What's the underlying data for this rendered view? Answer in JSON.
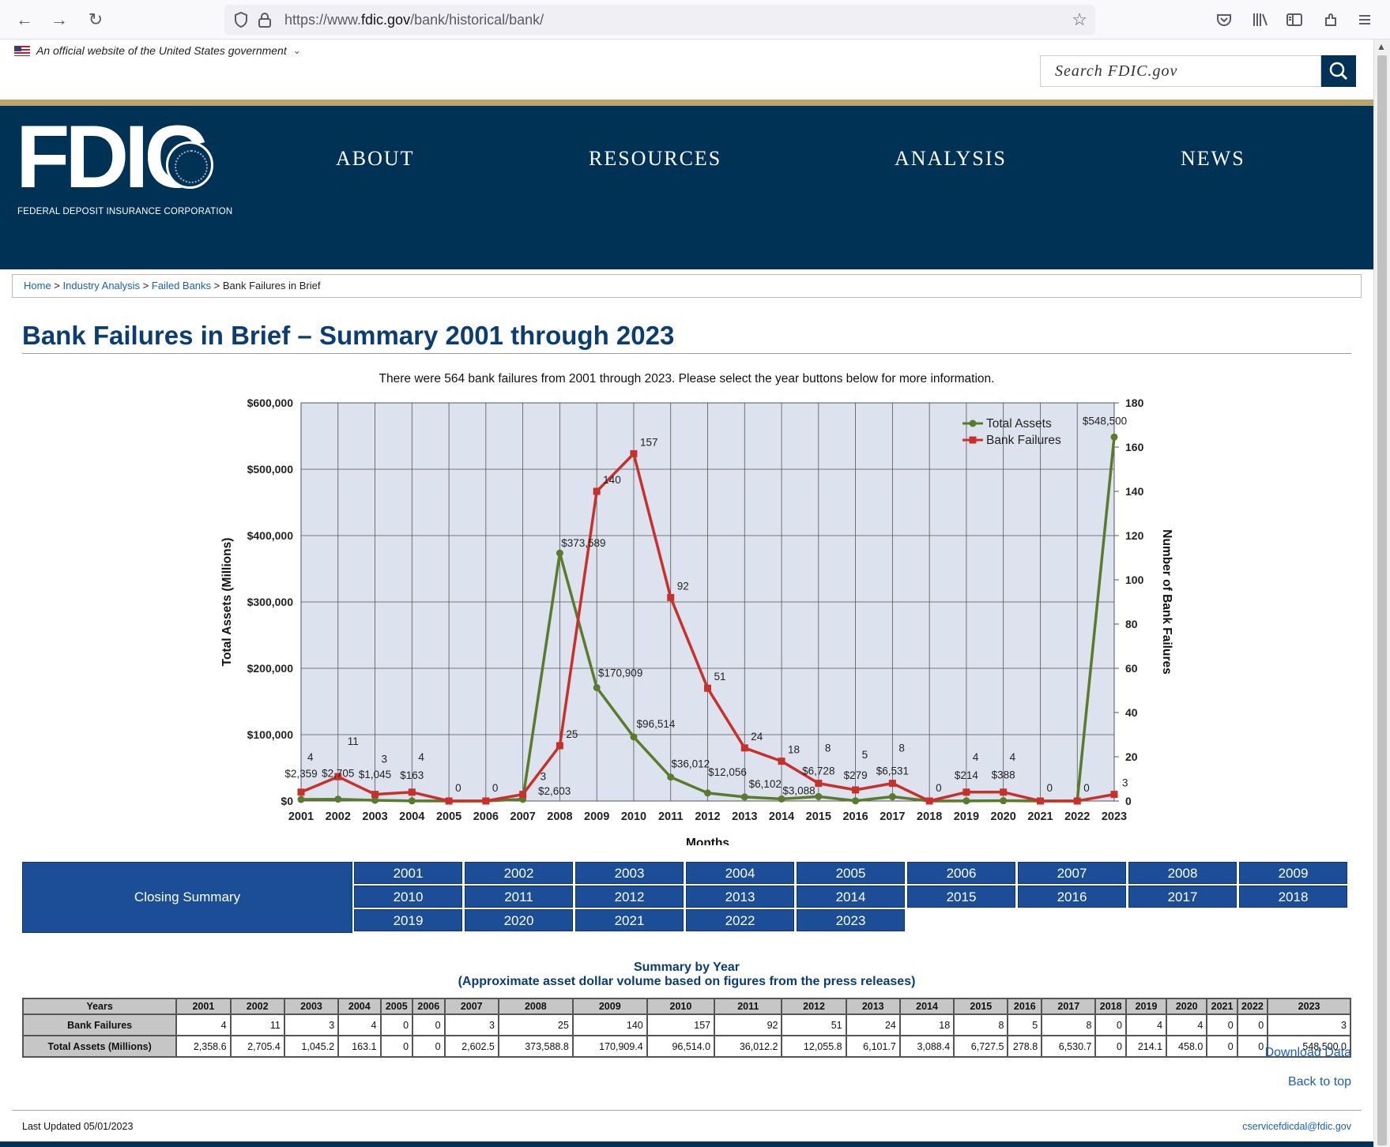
{
  "browser": {
    "back": "←",
    "forward": "→",
    "reload": "↻",
    "url_prefix": "https://www.",
    "url_domain": "fdic.gov",
    "url_path": "/bank/historical/bank/"
  },
  "gov_banner": {
    "text": "An official website of the United States government"
  },
  "search": {
    "placeholder": "Search FDIC.gov"
  },
  "logo": {
    "text": "FDIC",
    "subtitle": "FEDERAL DEPOSIT INSURANCE CORPORATION"
  },
  "nav": {
    "about": "ABOUT",
    "resources": "RESOURCES",
    "analysis": "ANALYSIS",
    "news": "NEWS"
  },
  "breadcrumb": {
    "home": "Home",
    "sep": " > ",
    "industry": "Industry Analysis",
    "failed": "Failed Banks",
    "current": "Bank Failures in Brief"
  },
  "page": {
    "title": "Bank Failures in Brief – Summary 2001 through 2023",
    "intro": "There were 564 bank failures from 2001 through 2023. Please select the year buttons below for more information."
  },
  "chart_data": {
    "type": "line",
    "xlabel": "Months",
    "ylabel": "Total Assets (Millions)",
    "y2label": "Number of Bank Failures",
    "x": [
      "2001",
      "2002",
      "2003",
      "2004",
      "2005",
      "2006",
      "2007",
      "2008",
      "2009",
      "2010",
      "2011",
      "2012",
      "2013",
      "2014",
      "2015",
      "2016",
      "2017",
      "2018",
      "2019",
      "2020",
      "2021",
      "2022",
      "2023"
    ],
    "ylim": [
      0,
      600000
    ],
    "y2lim": [
      0,
      180
    ],
    "yticks": [
      "$0",
      "$100,000",
      "$200,000",
      "$300,000",
      "$400,000",
      "$500,000",
      "$600,000"
    ],
    "y2ticks": [
      "0",
      "20",
      "40",
      "60",
      "80",
      "100",
      "120",
      "140",
      "160",
      "180"
    ],
    "legend_position": "top-right",
    "grid": true,
    "colors": {
      "total_assets": "#5a7a2e",
      "bank_failures": "#c8302c",
      "plot_bg": "#dde3ee"
    },
    "series": [
      {
        "name": "Total Assets",
        "axis": "left",
        "values": [
          2359,
          2705,
          1045,
          163,
          0,
          0,
          2603,
          373589,
          170909,
          96514,
          36012,
          12056,
          6102,
          3088,
          6728,
          279,
          6531,
          0,
          214,
          388,
          0,
          0,
          548500
        ],
        "labels": [
          "$2,359",
          "$2,705",
          "$1,045",
          "$163",
          "",
          "",
          "$2,603",
          "$373,589",
          "$170,909",
          "$96,514",
          "$36,012",
          "$12,056",
          "$6,102",
          "$3,088",
          "$6,728",
          "$279",
          "$6,531",
          "",
          "$214",
          "$388",
          "",
          "",
          "$548,500"
        ]
      },
      {
        "name": "Bank Failures",
        "axis": "right",
        "values": [
          4,
          11,
          3,
          4,
          0,
          0,
          3,
          25,
          140,
          157,
          92,
          51,
          24,
          18,
          8,
          5,
          8,
          0,
          4,
          4,
          0,
          0,
          3
        ],
        "labels": [
          "4",
          "11",
          "3",
          "4",
          "0",
          "0",
          "3",
          "25",
          "140",
          "157",
          "92",
          "51",
          "24",
          "18",
          "8",
          "5",
          "8",
          "0",
          "4",
          "4",
          "0",
          "0",
          "3"
        ]
      }
    ]
  },
  "closing_summary": "Closing Summary",
  "year_buttons": [
    "2001",
    "2002",
    "2003",
    "2004",
    "2005",
    "2006",
    "2007",
    "2008",
    "2009",
    "2010",
    "2011",
    "2012",
    "2013",
    "2014",
    "2015",
    "2016",
    "2017",
    "2018",
    "2019",
    "2020",
    "2021",
    "2022",
    "2023"
  ],
  "summary": {
    "title": "Summary by Year",
    "subtitle": "(Approximate asset dollar volume based on figures from the press releases)",
    "header_years": "Years",
    "row_failures": "Bank Failures",
    "row_assets": "Total Assets (Millions)",
    "years": [
      "2001",
      "2002",
      "2003",
      "2004",
      "2005",
      "2006",
      "2007",
      "2008",
      "2009",
      "2010",
      "2011",
      "2012",
      "2013",
      "2014",
      "2015",
      "2016",
      "2017",
      "2018",
      "2019",
      "2020",
      "2021",
      "2022",
      "2023"
    ],
    "failures": [
      "4",
      "11",
      "3",
      "4",
      "0",
      "0",
      "3",
      "25",
      "140",
      "157",
      "92",
      "51",
      "24",
      "18",
      "8",
      "5",
      "8",
      "0",
      "4",
      "4",
      "0",
      "0",
      "3"
    ],
    "assets": [
      "2,358.6",
      "2,705.4",
      "1,045.2",
      "163.1",
      "0",
      "0",
      "2,602.5",
      "373,588.8",
      "170,909.4",
      "96,514.0",
      "36,012.2",
      "12,055.8",
      "6,101.7",
      "3,088.4",
      "6,727.5",
      "278.8",
      "6,530.7",
      "0",
      "214.1",
      "458.0",
      "0",
      "0",
      "548,500.0"
    ]
  },
  "links": {
    "download": "Download Data",
    "back_to_top": "Back to top"
  },
  "footer": {
    "last_updated": "Last Updated 05/01/2023",
    "contact": "cservicefdicdal@fdic.gov"
  }
}
